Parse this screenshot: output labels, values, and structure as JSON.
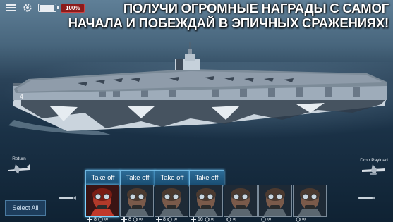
{
  "hud": {
    "battery_percent": "100%",
    "battery_level": 1.0
  },
  "headline": {
    "line1": "ПОЛУЧИ ОГРОМНЫЕ НАГРАДЫ С САМОГ",
    "line2": "НАЧАЛА И ПОБЕЖДАЙ В ЭПИЧНЫХ СРАЖЕНИЯХ!"
  },
  "side_buttons": {
    "return_label": "Return",
    "drop_payload_label": "Drop Payload"
  },
  "select_all_label": "Select All",
  "squadrons": [
    {
      "take_off_label": "Take off",
      "count": "8",
      "reserve": "∞",
      "plane_icon": "dive-bomber-icon",
      "selected": true
    },
    {
      "take_off_label": "Take off",
      "count": "8",
      "reserve": "∞",
      "plane_icon": "fighter-icon",
      "selected": false
    },
    {
      "take_off_label": "Take off",
      "count": "8",
      "reserve": "∞",
      "plane_icon": "torpedo-bomber-icon",
      "selected": false
    },
    {
      "take_off_label": "Take off",
      "count": "16",
      "reserve": "∞",
      "plane_icon": "fighter-icon",
      "selected": false
    },
    {
      "take_off_label": "",
      "count": "",
      "reserve": "∞",
      "plane_icon": "",
      "selected": false
    },
    {
      "take_off_label": "",
      "count": "",
      "reserve": "∞",
      "plane_icon": "",
      "selected": false
    },
    {
      "take_off_label": "",
      "count": "",
      "reserve": "∞",
      "plane_icon": "",
      "selected": false
    }
  ],
  "colors": {
    "take_off_button": "#1f5a82",
    "selected_border": "#7dd3ff",
    "battery_badge": "#8c1b1b",
    "hull_camo_light": "#b9c6d2",
    "hull_camo_dark": "#2b3744"
  }
}
